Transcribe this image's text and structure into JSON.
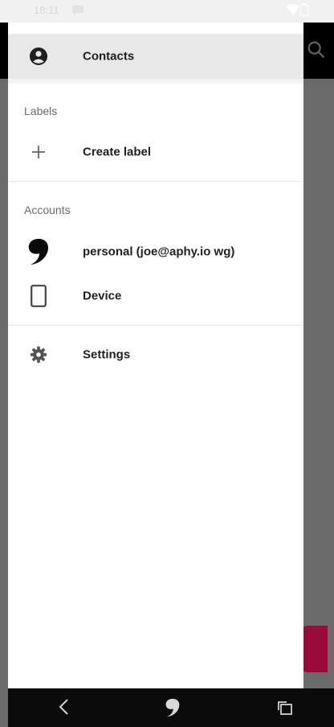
{
  "status_bar": {
    "time": "18:11"
  },
  "drawer": {
    "contacts_label": "Contacts",
    "labels_section_title": "Labels",
    "create_label": "Create label",
    "accounts_section_title": "Accounts",
    "accounts": [
      {
        "label": "personal (joe@aphy.io wg)",
        "icon": "account-icon"
      },
      {
        "label": "Device",
        "icon": "phone-device-icon"
      }
    ],
    "settings_label": "Settings"
  },
  "colors": {
    "drawer_bg": "#ffffff",
    "selected_row_bg": "#e8e8e8",
    "scrim": "#6b6b6b",
    "fab": "#9a0a3b",
    "nav_bar": "#0b0b0b"
  }
}
